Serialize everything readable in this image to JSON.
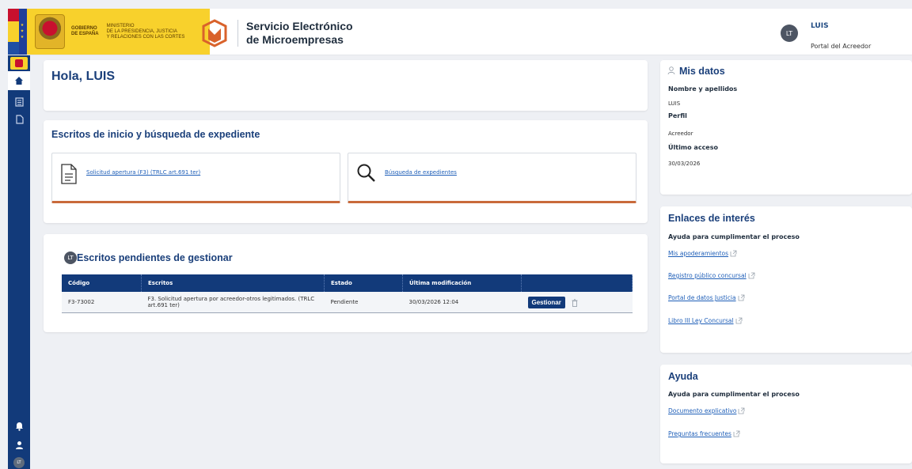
{
  "header": {
    "gov_text": "GOBIERNO\nDE ESPAÑA",
    "ministry_text": "MINISTERIO\nDE LA PRESIDENCIA, JUSTICIA\nY RELACIONES CON LAS CORTES",
    "app_title": "Servicio Electrónico\nde Microempresas",
    "user_initials": "LT",
    "user_name": "LUIS",
    "user_role": "Portal del Acreedor"
  },
  "sidebar": {
    "avatar_initials": "LT"
  },
  "greeting": {
    "title": "Hola, LUIS"
  },
  "escritos": {
    "title": "Escritos de inicio y búsqueda de expediente",
    "tile_solicitud": "Solicitud apertura (F3) (TRLC art.691 ter)",
    "tile_busqueda": "Búsqueda de expedientes"
  },
  "pendientes": {
    "badge": "LT",
    "title": "Escritos pendientes de gestionar",
    "columns": [
      "Código",
      "Escritos",
      "Estado",
      "Última modificación",
      ""
    ],
    "rows": [
      {
        "codigo": "F3-73002",
        "escritos": "F3. Solicitud apertura por acreedor-otros legitimados. (TRLC art.691 ter)",
        "estado": "Pendiente",
        "modificacion": "30/03/2026 12:04",
        "action": "Gestionar"
      }
    ]
  },
  "mis_datos": {
    "title": "Mis datos",
    "nombre_label": "Nombre y apellidos",
    "nombre_value": "LUIS",
    "perfil_label": "Perfil",
    "perfil_value": "Acreedor",
    "acceso_label": "Último acceso",
    "acceso_value": "30/03/2026"
  },
  "enlaces": {
    "title": "Enlaces de interés",
    "subtitle": "Ayuda para cumplimentar el proceso",
    "links": [
      "Mis apoderamientos",
      "Registro público concursal",
      "Portal de datos Justicia",
      "Libro III Ley Concursal"
    ]
  },
  "ayuda": {
    "title": "Ayuda",
    "subtitle": "Ayuda para cumplimentar el proceso",
    "links": [
      "Documento explicativo",
      "Preguntas frecuentes"
    ]
  },
  "colors": {
    "primary": "#123a7a",
    "heading": "#1a3f7a",
    "link": "#1f5fb8",
    "accent_orange": "#c96a3b",
    "gov_yellow": "#f8d12c"
  }
}
